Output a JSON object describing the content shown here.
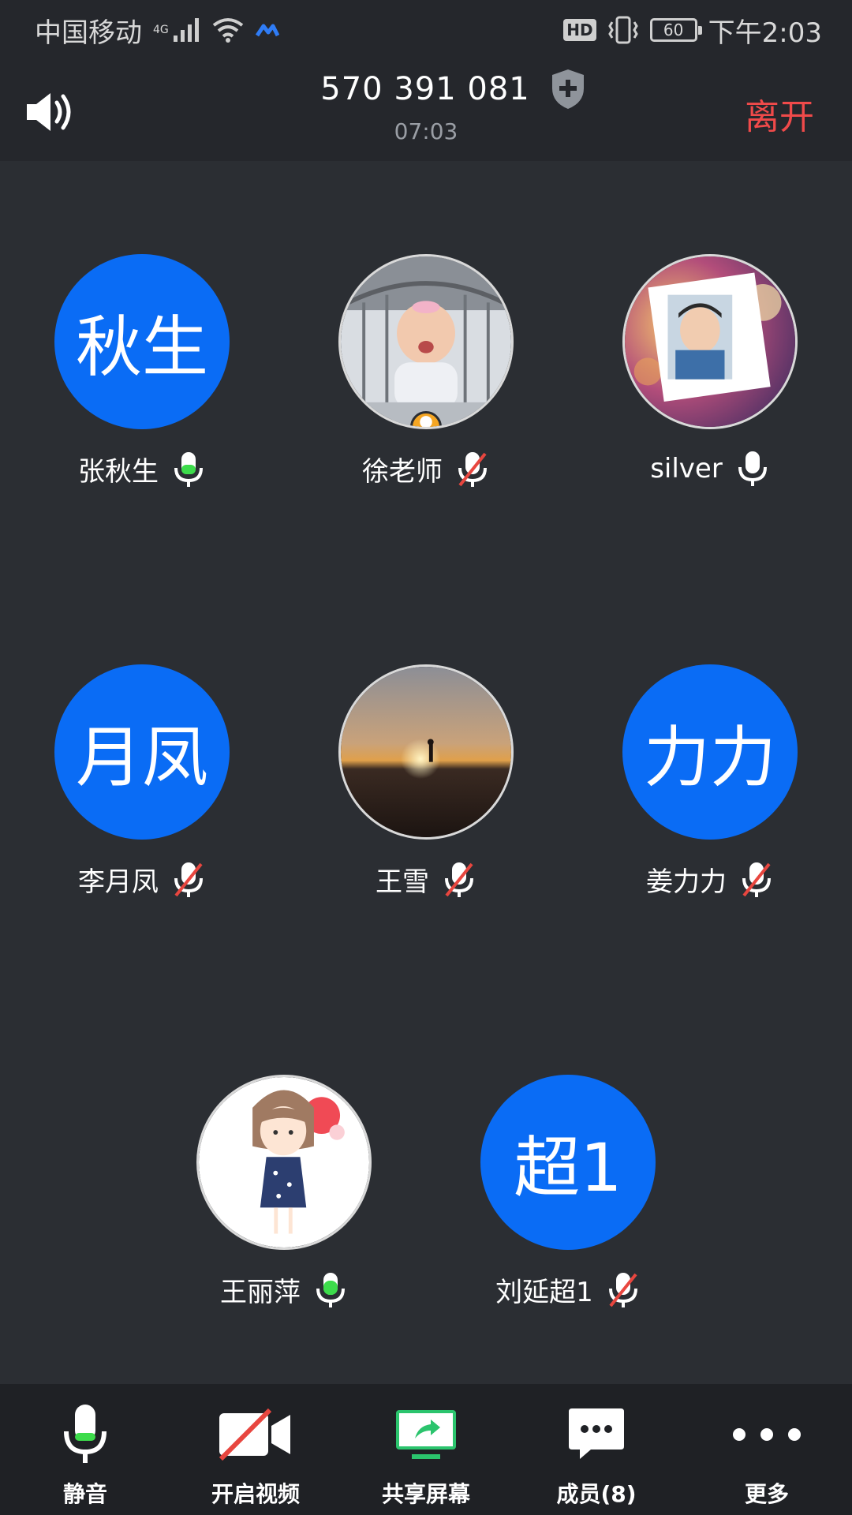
{
  "status_bar": {
    "carrier": "中国移动",
    "network": "4G",
    "battery": "60",
    "time": "下午2:03",
    "hd": "HD"
  },
  "header": {
    "meeting_id": "570 391 081",
    "duration": "07:03",
    "leave_label": "离开"
  },
  "participants": [
    {
      "name": "张秋生",
      "avatar_text": "秋生",
      "avatar_type": "text",
      "mic": "active"
    },
    {
      "name": "徐老师",
      "avatar_type": "photo",
      "photo": "baby-photo",
      "mic": "muted",
      "host": true
    },
    {
      "name": "silver",
      "avatar_type": "photo",
      "photo": "person-photo",
      "mic": "on"
    },
    {
      "name": "李月凤",
      "avatar_text": "月凤",
      "avatar_type": "text",
      "mic": "muted"
    },
    {
      "name": "王雪",
      "avatar_type": "photo",
      "photo": "sunset-photo",
      "mic": "muted"
    },
    {
      "name": "姜力力",
      "avatar_text": "力力",
      "avatar_type": "text",
      "mic": "muted"
    },
    {
      "name": "王丽萍",
      "avatar_type": "photo",
      "photo": "cartoon-girl-photo",
      "mic": "active"
    },
    {
      "name": "刘延超1",
      "avatar_text": "超1",
      "avatar_type": "text",
      "mic": "muted"
    }
  ],
  "toolbar": {
    "mute_label": "静音",
    "video_label": "开启视频",
    "share_label": "共享屏幕",
    "members_label": "成员(8)",
    "more_label": "更多"
  },
  "colors": {
    "background": "#2b2e33",
    "avatar_blue": "#0a6cf5",
    "leave_red": "#f04a4a",
    "mic_active_green": "#3ddc4b",
    "host_badge": "#f5a623",
    "share_green": "#2bc46d"
  }
}
